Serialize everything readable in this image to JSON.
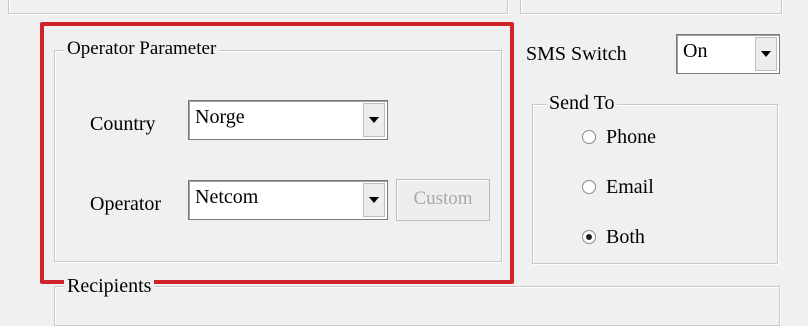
{
  "operator_group": {
    "legend": "Operator Parameter",
    "country_label": "Country",
    "country_value": "Norge",
    "operator_label": "Operator",
    "operator_value": "Netcom",
    "custom_button": "Custom"
  },
  "sms": {
    "switch_label": "SMS Switch",
    "switch_value": "On"
  },
  "send_to": {
    "legend": "Send To",
    "options": [
      {
        "label": "Phone",
        "checked": false
      },
      {
        "label": "Email",
        "checked": false
      },
      {
        "label": "Both",
        "checked": true
      }
    ]
  },
  "recipients": {
    "legend": "Recipients"
  },
  "colors": {
    "highlight": "#d0232a",
    "window_bg": "#f0f0f0"
  }
}
